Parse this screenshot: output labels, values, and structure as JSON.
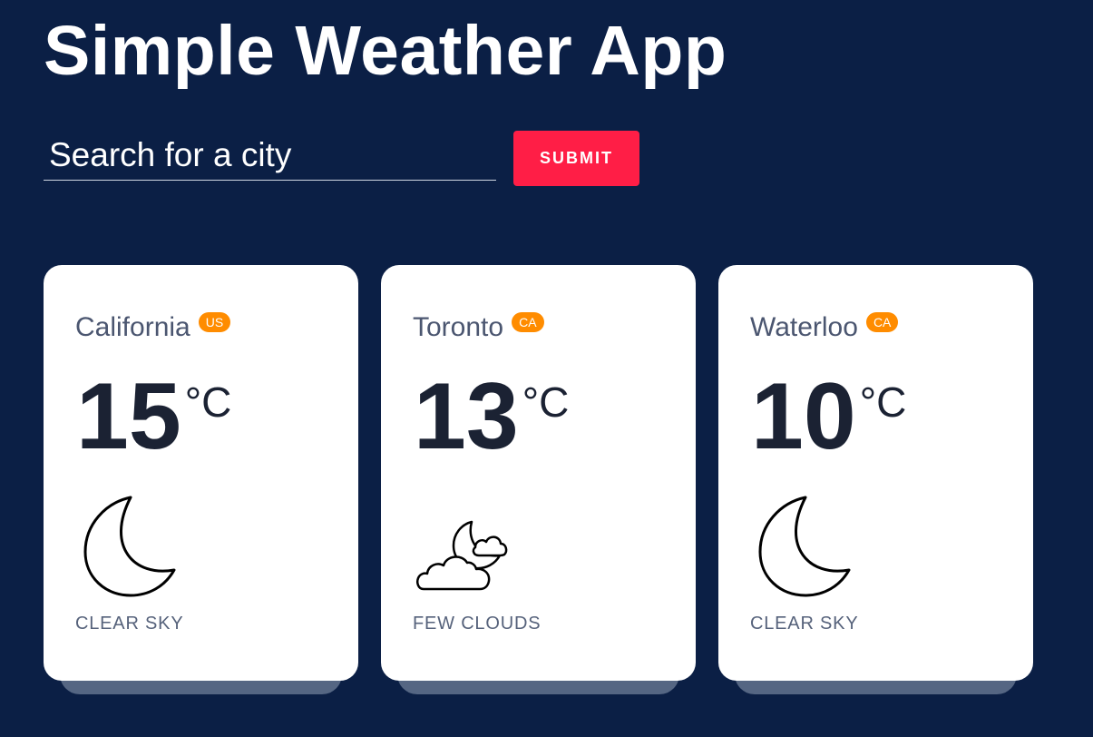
{
  "header": {
    "title": "Simple Weather App"
  },
  "search": {
    "placeholder": "Search for a city",
    "value": "",
    "submit_label": "SUBMIT"
  },
  "colors": {
    "background": "#0b1f45",
    "accent": "#ff1e46",
    "badge": "#ff8c00",
    "card": "#ffffff"
  },
  "cards": [
    {
      "city": "California",
      "country": "US",
      "temp": "15",
      "unit": "°C",
      "icon": "moon-icon",
      "description": "CLEAR SKY"
    },
    {
      "city": "Toronto",
      "country": "CA",
      "temp": "13",
      "unit": "°C",
      "icon": "clouds-moon-icon",
      "description": "FEW CLOUDS"
    },
    {
      "city": "Waterloo",
      "country": "CA",
      "temp": "10",
      "unit": "°C",
      "icon": "moon-icon",
      "description": "CLEAR SKY"
    }
  ]
}
